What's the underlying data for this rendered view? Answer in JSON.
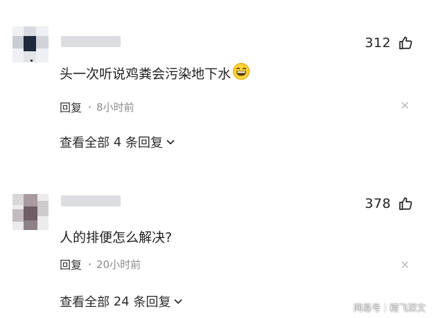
{
  "comments": [
    {
      "likes": "312",
      "text": "头一次听说鸡粪会污染地下水",
      "emoji": "grinning-face-emoji",
      "reply_label": "回复",
      "time": "8小时前",
      "view_all_prefix": "查看全部",
      "reply_count": "4",
      "view_all_suffix": "条回复"
    },
    {
      "likes": "378",
      "text": "人的排便怎么解决?",
      "reply_label": "回复",
      "time": "20小时前",
      "view_all_prefix": "查看全部",
      "reply_count": "24",
      "view_all_suffix": "条回复"
    }
  ],
  "watermark": {
    "brand": "网易号",
    "author": "精飞深文"
  },
  "icons": {
    "like": "thumbs-up-icon",
    "dismiss": "close-icon",
    "expand": "chevron-down-icon"
  },
  "colors": {
    "text": "#1f1f1f",
    "muted": "#8a8a8a",
    "username_blur": "#dcdde0"
  }
}
